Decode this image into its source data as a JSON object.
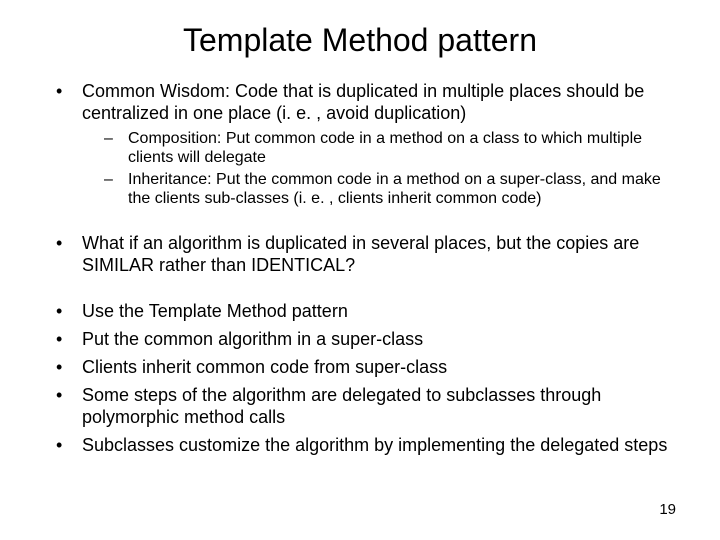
{
  "title": "Template Method pattern",
  "bullets": {
    "b1": "Common Wisdom: Code that is duplicated in multiple places should be centralized in one place (i. e. , avoid duplication)",
    "b1_sub1": "Composition: Put common code in a method on a class to which multiple clients will delegate",
    "b1_sub2": "Inheritance: Put the common code in a method on a super-class, and make the clients sub-classes (i. e. , clients inherit common code)",
    "b2": "What if an algorithm is duplicated in several places, but the copies are SIMILAR rather than IDENTICAL?",
    "b3": "Use the Template Method pattern",
    "b4": "Put the common algorithm in a super-class",
    "b5": "Clients inherit common code from super-class",
    "b6": "Some steps of the algorithm are delegated to subclasses through polymorphic method calls",
    "b7": "Subclasses customize the algorithm by implementing the delegated steps"
  },
  "page_number": "19"
}
